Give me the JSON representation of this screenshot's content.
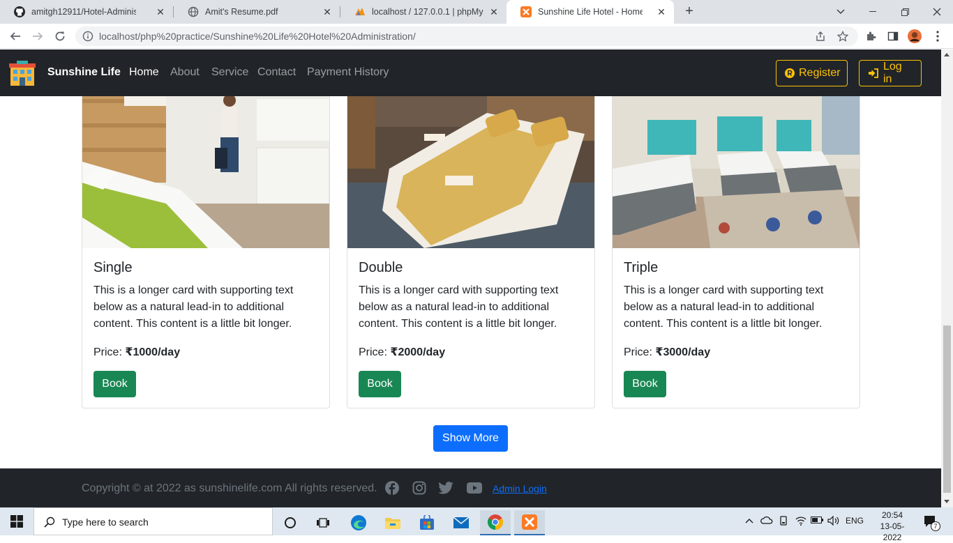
{
  "browser": {
    "tabs": [
      {
        "title": "amitgh12911/Hotel-Administratio",
        "icon": "github-icon"
      },
      {
        "title": "Amit's Resume.pdf",
        "icon": "globe-icon"
      },
      {
        "title": "localhost / 127.0.0.1 | phpMyAdm",
        "icon": "phpmyadmin-icon"
      },
      {
        "title": "Sunshine Life Hotel - Home",
        "icon": "xampp-icon"
      }
    ],
    "url": "localhost/php%20practice/Sunshine%20Life%20Hotel%20Administration/"
  },
  "site": {
    "brand": "Sunshine Life",
    "nav": [
      "Home",
      "About",
      "Service",
      "Contact",
      "Payment History"
    ],
    "register_label": "Register",
    "login_label": "Log in",
    "cards": [
      {
        "title": "Single",
        "text": "This is a longer card with supporting text below as a natural lead-in to additional content. This content is a little bit longer.",
        "price_label": "Price: ",
        "price": "₹1000/day",
        "button": "Book"
      },
      {
        "title": "Double",
        "text": "This is a longer card with supporting text below as a natural lead-in to additional content. This content is a little bit longer.",
        "price_label": "Price: ",
        "price": "₹2000/day",
        "button": "Book"
      },
      {
        "title": "Triple",
        "text": "This is a longer card with supporting text below as a natural lead-in to additional content. This content is a little bit longer.",
        "price_label": "Price: ",
        "price": "₹3000/day",
        "button": "Book"
      }
    ],
    "show_more": "Show More",
    "footer": {
      "copyright": "Copyright © at 2022 as sunshinelife.com All rights reserved.",
      "admin_login": "Admin Login"
    },
    "colors": {
      "navbar": "#212529",
      "warning": "#ffc107",
      "success": "#198754",
      "primary": "#0d6efd"
    }
  },
  "taskbar": {
    "search_placeholder": "Type here to search",
    "language": "ENG",
    "time": "20:54",
    "date": "13-05-2022",
    "notification_count": "7"
  }
}
